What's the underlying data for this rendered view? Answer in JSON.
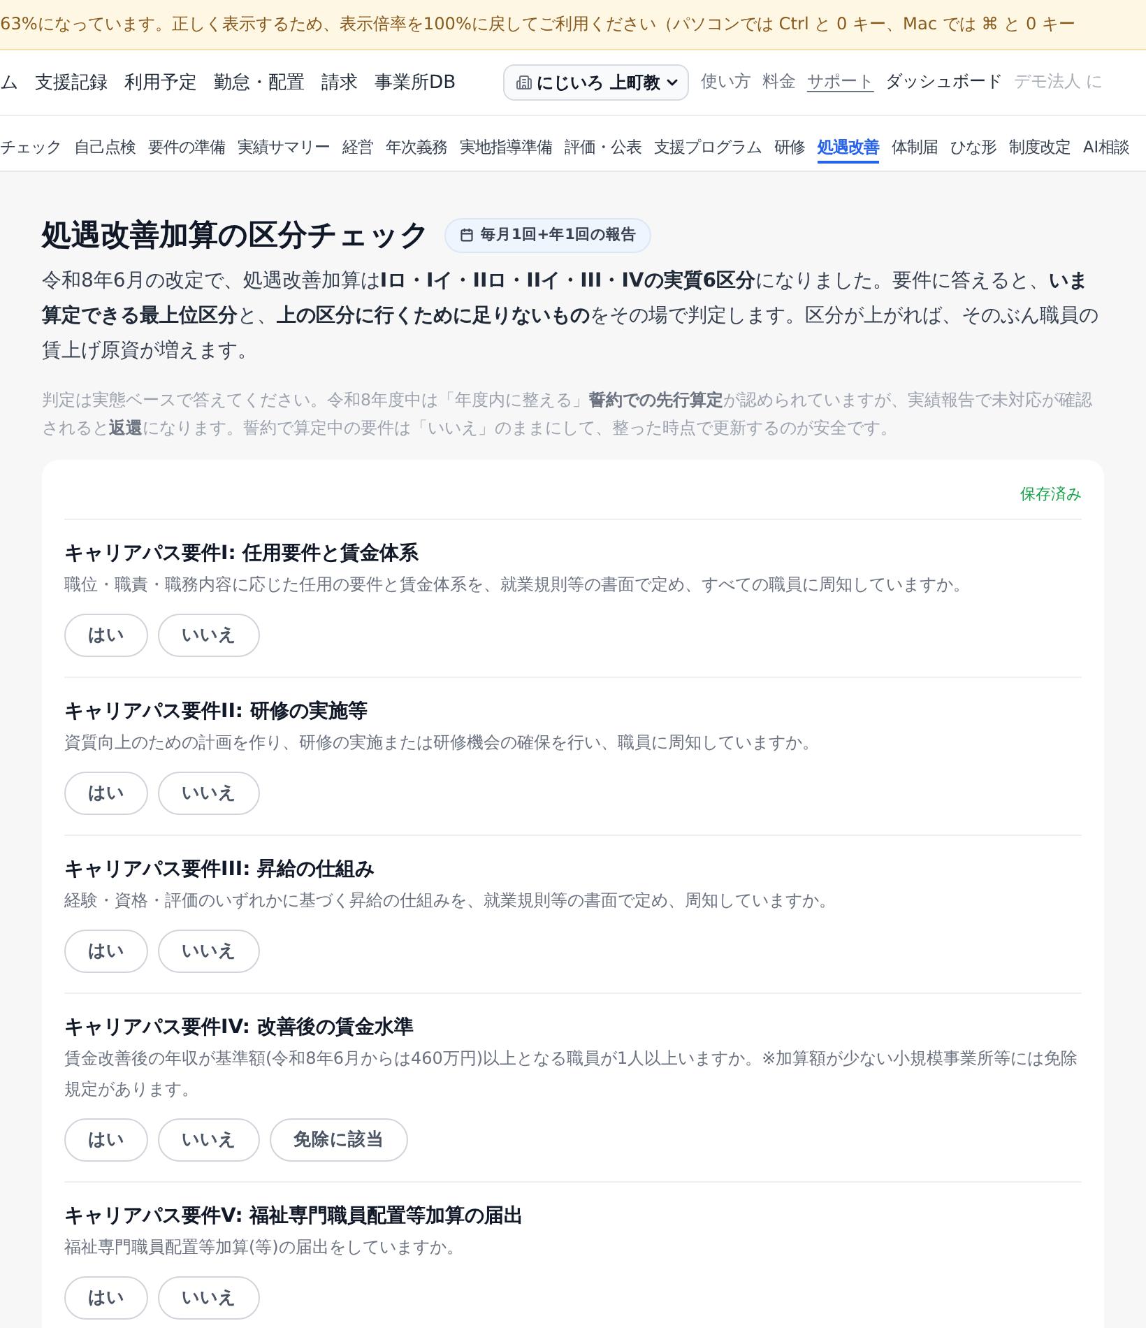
{
  "banner": {
    "text": "63%になっています。正しく表示するため、表示倍率を100%に戻してご利用ください（パソコンでは Ctrl と 0 キー、Mac では ⌘ と 0 キー"
  },
  "nav": {
    "items": [
      {
        "label": "ム",
        "selected": false
      },
      {
        "label": "支援記録",
        "selected": false
      },
      {
        "label": "利用予定",
        "selected": false
      },
      {
        "label": "勤怠・配置",
        "selected": false
      },
      {
        "label": "請求",
        "selected": false
      },
      {
        "label": "事業所DB",
        "selected": false
      }
    ],
    "office_select": {
      "value": "にじいろ 上町教"
    },
    "links": [
      {
        "label": "使い方",
        "kind": "muted"
      },
      {
        "label": "料金",
        "kind": "muted"
      },
      {
        "label": "サポート",
        "kind": "underlined"
      },
      {
        "label": "ダッシュボード",
        "kind": "strong"
      },
      {
        "label": "デモ法人 に",
        "kind": "faint"
      }
    ]
  },
  "subnav": {
    "items": [
      {
        "label": "チェック",
        "selected": false
      },
      {
        "label": "自己点検",
        "selected": false
      },
      {
        "label": "要件の準備",
        "selected": false
      },
      {
        "label": "実績サマリー",
        "selected": false
      },
      {
        "label": "経営",
        "selected": false
      },
      {
        "label": "年次義務",
        "selected": false
      },
      {
        "label": "実地指導準備",
        "selected": false
      },
      {
        "label": "評価・公表",
        "selected": false
      },
      {
        "label": "支援プログラム",
        "selected": false
      },
      {
        "label": "研修",
        "selected": false
      },
      {
        "label": "処遇改善",
        "selected": true
      },
      {
        "label": "体制届",
        "selected": false
      },
      {
        "label": "ひな形",
        "selected": false
      },
      {
        "label": "制度改定",
        "selected": false
      },
      {
        "label": "AI相談",
        "selected": false
      }
    ]
  },
  "page": {
    "title": "処遇改善加算の区分チェック",
    "badge": "毎月1回+年1回の報告",
    "description": "令和8年6月の改定で、処遇改善加算は**Iロ・Iイ・IIロ・IIイ・III・IVの実質6区分**になりました。要件に答えると、**いま算定できる最上位区分**と、**上の区分に行くために足りないもの**をその場で判定します。区分が上がれば、そのぶん職員の賃上げ原資が増えます。",
    "note": "判定は実態ベースで答えてください。令和8年度中は「年度内に整える」**誓約での先行算定**が認められていますが、実績報告で未対応が確認されると**返還**になります。誓約で算定中の要件は「いいえ」のままにして、整った時点で更新するのが安全です。"
  },
  "card": {
    "save_status": "保存済み",
    "questions": [
      {
        "title": "キャリアパス要件I: 任用要件と賃金体系",
        "description": "職位・職責・職務内容に応じた任用の要件と賃金体系を、就業規則等の書面で定め、すべての職員に周知していますか。",
        "options": [
          {
            "label": "はい",
            "selected": false
          },
          {
            "label": "いいえ",
            "selected": false
          }
        ]
      },
      {
        "title": "キャリアパス要件II: 研修の実施等",
        "description": "資質向上のための計画を作り、研修の実施または研修機会の確保を行い、職員に周知していますか。",
        "options": [
          {
            "label": "はい",
            "selected": false
          },
          {
            "label": "いいえ",
            "selected": false
          }
        ]
      },
      {
        "title": "キャリアパス要件III: 昇給の仕組み",
        "description": "経験・資格・評価のいずれかに基づく昇給の仕組みを、就業規則等の書面で定め、周知していますか。",
        "options": [
          {
            "label": "はい",
            "selected": false
          },
          {
            "label": "いいえ",
            "selected": false
          }
        ]
      },
      {
        "title": "キャリアパス要件IV: 改善後の賃金水準",
        "description": "賃金改善後の年収が基準額(令和8年6月からは460万円)以上となる職員が1人以上いますか。※加算額が少ない小規模事業所等には免除規定があります。",
        "options": [
          {
            "label": "はい",
            "selected": false
          },
          {
            "label": "いいえ",
            "selected": false
          },
          {
            "label": "免除に該当",
            "selected": false
          }
        ]
      },
      {
        "title": "キャリアパス要件V: 福祉専門職員配置等加算の届出",
        "description": "福祉専門職員配置等加算(等)の届出をしていますか。",
        "options": [
          {
            "label": "はい",
            "selected": false
          },
          {
            "label": "いいえ",
            "selected": false
          }
        ]
      }
    ]
  }
}
